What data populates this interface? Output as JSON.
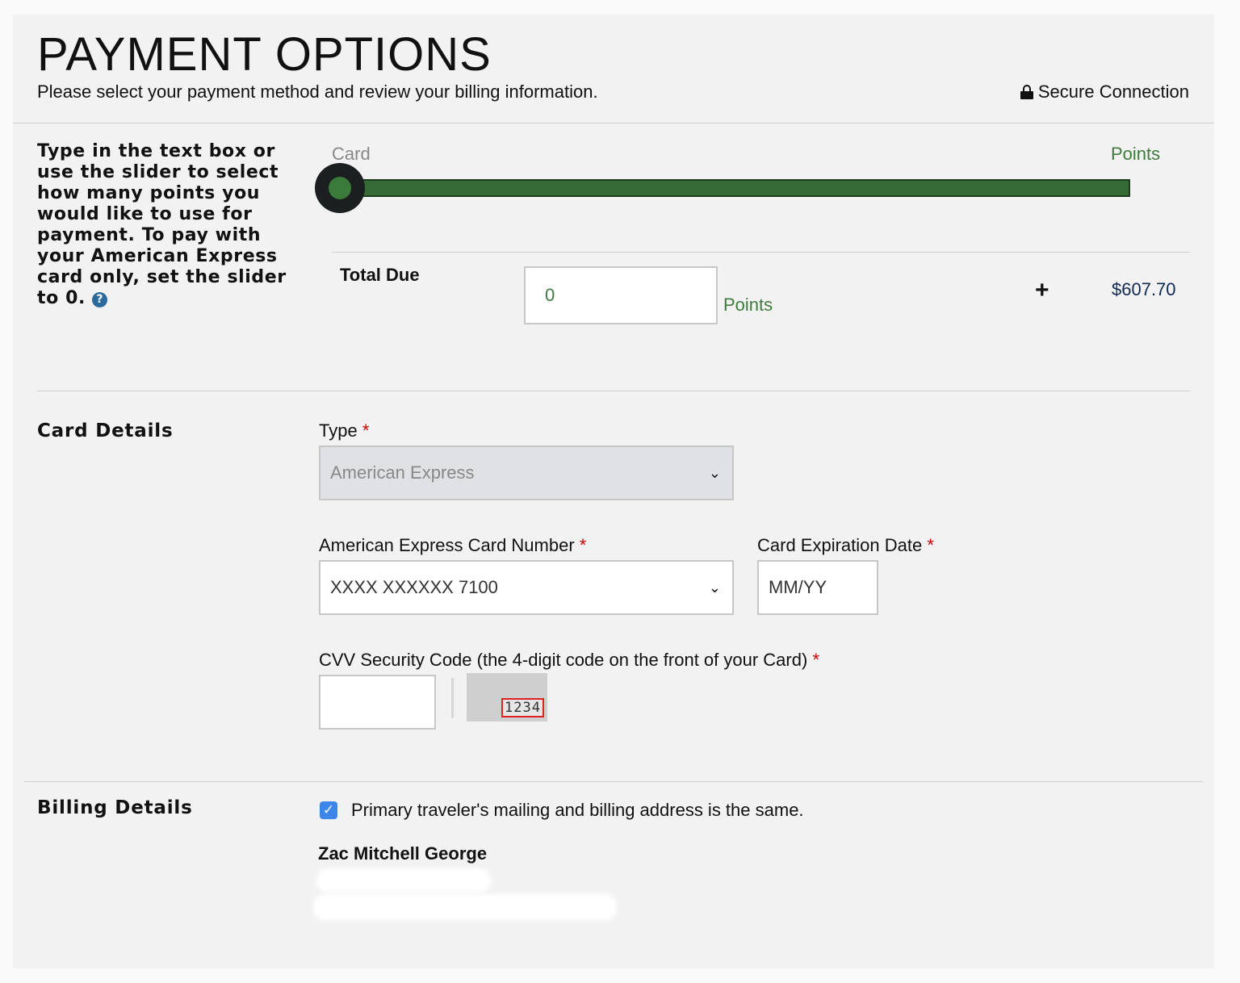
{
  "header": {
    "title": "PAYMENT OPTIONS",
    "subtitle": "Please select your payment method and review your billing information.",
    "secure_label": "Secure Connection"
  },
  "slider": {
    "help_text": "Type in the text box or use the slider to select how many points you would like to use for payment. To pay with your American Express card only, set the slider to 0.",
    "label_left": "Card",
    "label_right": "Points",
    "level": 0
  },
  "total": {
    "label": "Total Due",
    "points_value": "0",
    "points_unit": "Points",
    "plus": "+",
    "amount": "$607.70"
  },
  "card_details": {
    "section_label": "Card Details",
    "type_label": "Type",
    "type_value": "American Express",
    "card_number_label": "American Express Card Number",
    "card_number_value": "XXXX XXXXXX 7100",
    "expiration_label": "Card Expiration Date",
    "expiration_placeholder": "MM/YY",
    "cvv_label": "CVV Security Code (the 4-digit code on the front of your Card)",
    "cvv_sample": "1234",
    "required_mark": "*"
  },
  "billing": {
    "section_label": "Billing Details",
    "same_address_label": "Primary traveler's mailing and billing address is the same.",
    "same_address_checked": true,
    "name": "Zac Mitchell George"
  },
  "colors": {
    "points_green": "#3f7a3f",
    "amount_navy": "#0f2a55",
    "required_red": "#cc0000",
    "checkbox_blue": "#3b86e8"
  }
}
